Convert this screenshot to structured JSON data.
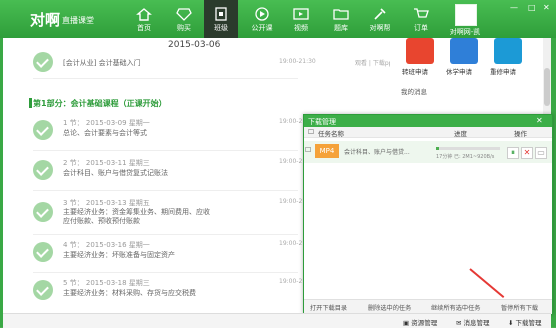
{
  "app": {
    "logo": "对啊",
    "logo_sub": "直播课堂",
    "nav": [
      {
        "label": "首页",
        "icon": "home-icon"
      },
      {
        "label": "购买",
        "icon": "diamond-icon"
      },
      {
        "label": "班级",
        "icon": "class-icon"
      },
      {
        "label": "公开课",
        "icon": "play-icon"
      },
      {
        "label": "视频",
        "icon": "video-icon"
      },
      {
        "label": "题库",
        "icon": "folder-icon"
      },
      {
        "label": "对啊帮",
        "icon": "tools-icon"
      },
      {
        "label": "订单",
        "icon": "cart-icon"
      },
      {
        "label": "对啊网-凯",
        "icon": "user-avatar"
      }
    ]
  },
  "main": {
    "date": "2015-03-06",
    "intro_lesson": {
      "title": "[会计从业] 会计基础入门",
      "time": "19:00-21:30",
      "watch": "观看 | 下载ppt"
    },
    "section_title": "第1部分：会计基础课程（正课开始）",
    "lessons": [
      {
        "meta": "1 节： 2015-03-09 星期一",
        "title": "总论、会计要素与会计等式"
      },
      {
        "meta": "2 节： 2015-03-11 星期三",
        "title": "会计科目、账户与借贷复式记账法"
      },
      {
        "meta": "3 节： 2015-03-13 星期五",
        "title": "主要经济业务：资金筹集业务、期间费用、应收应付账款、预收预付账款"
      },
      {
        "meta": "4 节： 2015-03-16 星期一",
        "title": "主要经济业务：坏账准备与固定资产"
      },
      {
        "meta": "5 节： 2015-03-18 星期三",
        "title": "主要经济业务：材料采购、存货与应交税费"
      }
    ],
    "lesson_time": "19:00-21:30"
  },
  "right": {
    "apps": [
      {
        "label": "转班申请",
        "color": "#e8452f"
      },
      {
        "label": "休学申请",
        "color": "#2f7fd8"
      },
      {
        "label": "重修申请",
        "color": "#1c9ad6"
      }
    ],
    "news_title": "我的消息"
  },
  "download_manager": {
    "title": "下载管理",
    "columns": {
      "name": "任务名称",
      "progress": "进度",
      "actions": "操作"
    },
    "task": {
      "type": "MP4",
      "name": "会计科目、账户与借贷...",
      "status": "17分钟 已: 2M1~920B/s",
      "progress": 0.05
    },
    "footer": [
      "打开下载目录",
      "删除选中的任务",
      "继续所有选中任务",
      "暂停所有下载"
    ]
  },
  "status_bar": {
    "resource": "资源管理",
    "messages": "消息管理",
    "downloads": "下载管理"
  },
  "colors": {
    "brand": "#3aa845",
    "accent": "#2e9c3b",
    "mp4": "#f5a23a",
    "alert": "#e53935"
  }
}
